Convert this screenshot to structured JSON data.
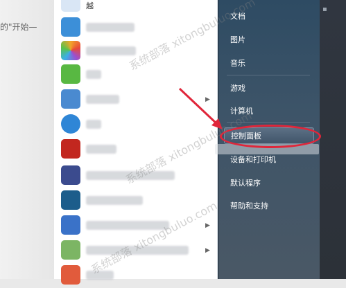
{
  "background": {
    "doc_text": "的\"开始—"
  },
  "start_menu": {
    "top_truncated_item": "越",
    "programs": [
      {
        "icon_color": "#3c8fd8"
      },
      {
        "icon_color": "#f39a2a"
      },
      {
        "icon_color": "#58b842"
      },
      {
        "icon_color": "#4a8ad0"
      },
      {
        "icon_color": "#2f86d6"
      },
      {
        "icon_color": "#c2271f"
      },
      {
        "icon_color": "#3b4b8e"
      },
      {
        "icon_color": "#1c5d8b"
      },
      {
        "icon_color": "#3a72c8"
      },
      {
        "icon_color": "#7cb564"
      },
      {
        "icon_color": "#e15b3c"
      }
    ],
    "right_items": [
      {
        "label": "文档"
      },
      {
        "label": "图片"
      },
      {
        "label": "音乐"
      },
      {
        "label": "游戏"
      },
      {
        "label": "计算机"
      },
      {
        "label": "控制面板"
      },
      {
        "label": "设备和打印机"
      },
      {
        "label": "默认程序"
      },
      {
        "label": "帮助和支持"
      }
    ]
  },
  "watermark": "系统部落 xitongbuluo.com",
  "colors": {
    "annotation": "#e0263a",
    "menu_right_bg": "#3d5468"
  }
}
